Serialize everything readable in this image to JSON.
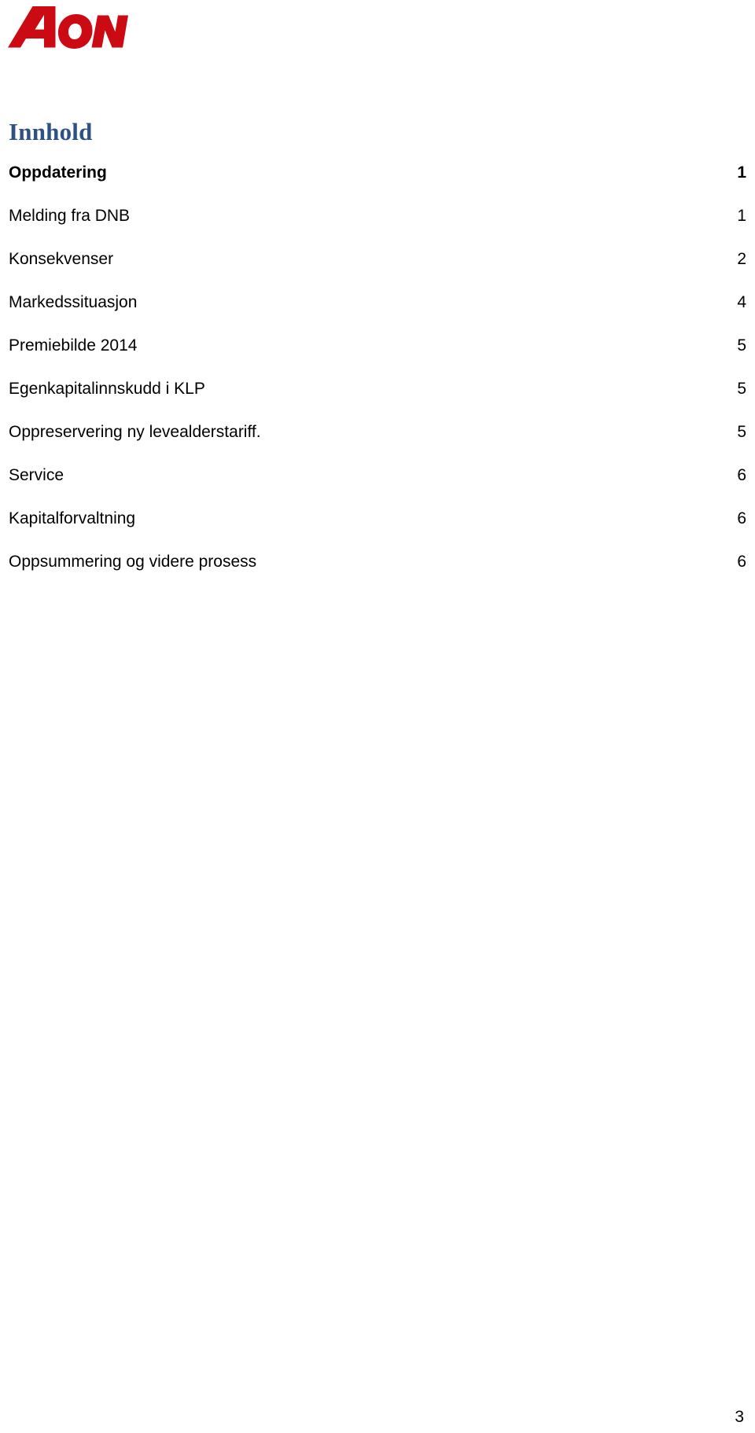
{
  "brand": {
    "logo_name": "aon-logo",
    "logo_text": "AON",
    "logo_color": "#CC0A14"
  },
  "heading": {
    "text": "Innhold",
    "color": "#2E5184"
  },
  "toc": {
    "entries": [
      {
        "label": "Oppdatering",
        "page": "1",
        "level": 1
      },
      {
        "label": "Melding fra DNB",
        "page": "1",
        "level": 2
      },
      {
        "label": "Konsekvenser",
        "page": "2",
        "level": 2
      },
      {
        "label": "Markedssituasjon",
        "page": "4",
        "level": 2
      },
      {
        "label": "Premiebilde 2014",
        "page": "5",
        "level": 2
      },
      {
        "label": "Egenkapitalinnskudd i KLP",
        "page": "5",
        "level": 2
      },
      {
        "label": "Oppreservering ny levealderstariff.",
        "page": "5",
        "level": 2
      },
      {
        "label": "Service",
        "page": "6",
        "level": 2
      },
      {
        "label": "Kapitalforvaltning",
        "page": "6",
        "level": 2
      },
      {
        "label": "Oppsummering og videre prosess",
        "page": "6",
        "level": 2
      }
    ]
  },
  "footer": {
    "page_number": "3"
  }
}
